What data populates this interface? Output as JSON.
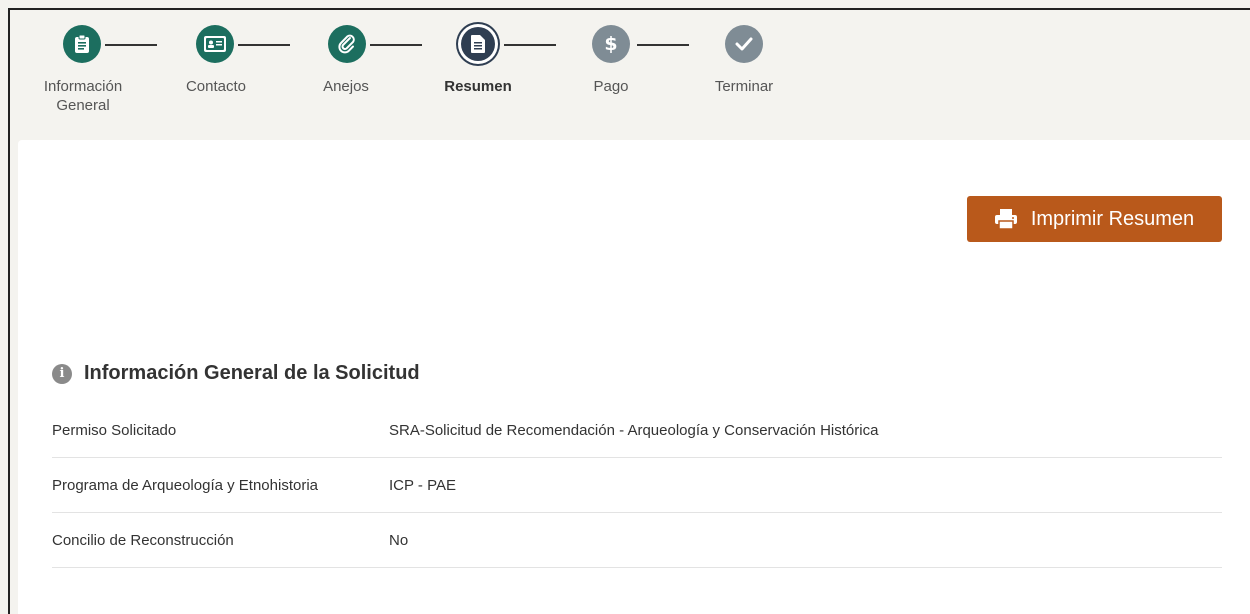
{
  "stepper": {
    "steps": [
      {
        "label_line1": "Información",
        "label_line2": "General",
        "state": "done",
        "icon": "clipboard-icon"
      },
      {
        "label_line1": "Contacto",
        "label_line2": "",
        "state": "done",
        "icon": "id-card-icon"
      },
      {
        "label_line1": "Anejos",
        "label_line2": "",
        "state": "done",
        "icon": "paperclip-icon"
      },
      {
        "label_line1": "Resumen",
        "label_line2": "",
        "state": "current",
        "icon": "document-icon"
      },
      {
        "label_line1": "Pago",
        "label_line2": "",
        "state": "future",
        "icon": "dollar-icon"
      },
      {
        "label_line1": "Terminar",
        "label_line2": "",
        "state": "future",
        "icon": "check-icon"
      }
    ]
  },
  "actions": {
    "print_label": "Imprimir Resumen",
    "print_icon": "printer-icon",
    "color": "#b9591b"
  },
  "summary": {
    "title": "Información General de la Solicitud",
    "icon": "info-icon",
    "rows": [
      {
        "label": "Permiso Solicitado",
        "value": "SRA-Solicitud de Recomendación - Arqueología y Conservación Histórica"
      },
      {
        "label": "Programa de Arqueología y Etnohistoria",
        "value": "ICP - PAE"
      },
      {
        "label": "Concilio de Reconstrucción",
        "value": "No"
      }
    ]
  },
  "colors": {
    "done": "#1c6e5f",
    "current": "#2f3e52",
    "future": "#7f8c95",
    "background": "#f4f3ef"
  }
}
